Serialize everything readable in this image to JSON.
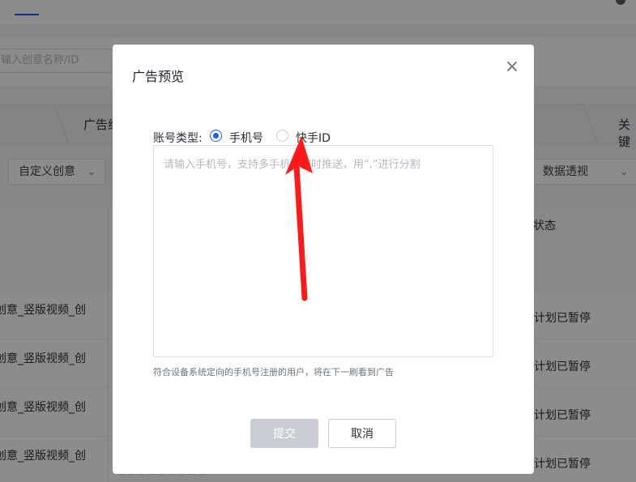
{
  "background": {
    "search_placeholder": "输入创意名称/ID",
    "tabs": [
      "广告组",
      "关键"
    ],
    "filters": {
      "creative": "自定义创意",
      "data_view": "数据透视"
    },
    "table_header_status": "状态",
    "rows": [
      {
        "name": "创意_竖版视频_创",
        "status": "计划已暂停"
      },
      {
        "name": "创意_竖版视频_创",
        "status": "计划已暂停"
      },
      {
        "name": "创意_竖版视频_创",
        "status": "计划已暂停"
      },
      {
        "name": "创意_竖版视频_创",
        "status": "计划已暂停"
      }
    ]
  },
  "modal": {
    "title": "广告预览",
    "close_symbol": "×",
    "account_type_label": "账号类型:",
    "options": [
      {
        "label": "手机号",
        "selected": true
      },
      {
        "label": "快手ID",
        "selected": false
      }
    ],
    "textarea_placeholder": "请输入手机号，支持多手机号同时推送，用“,”进行分割",
    "textarea_value": "",
    "hint": "符合设备系统定向的手机号注册的用户，将在下一刷看到广告",
    "submit_label": "提交",
    "cancel_label": "取消"
  },
  "colors": {
    "primary": "#1f5ef1",
    "annotation_arrow": "#ff1a1a",
    "disabled_button": "#c9ccd3"
  }
}
